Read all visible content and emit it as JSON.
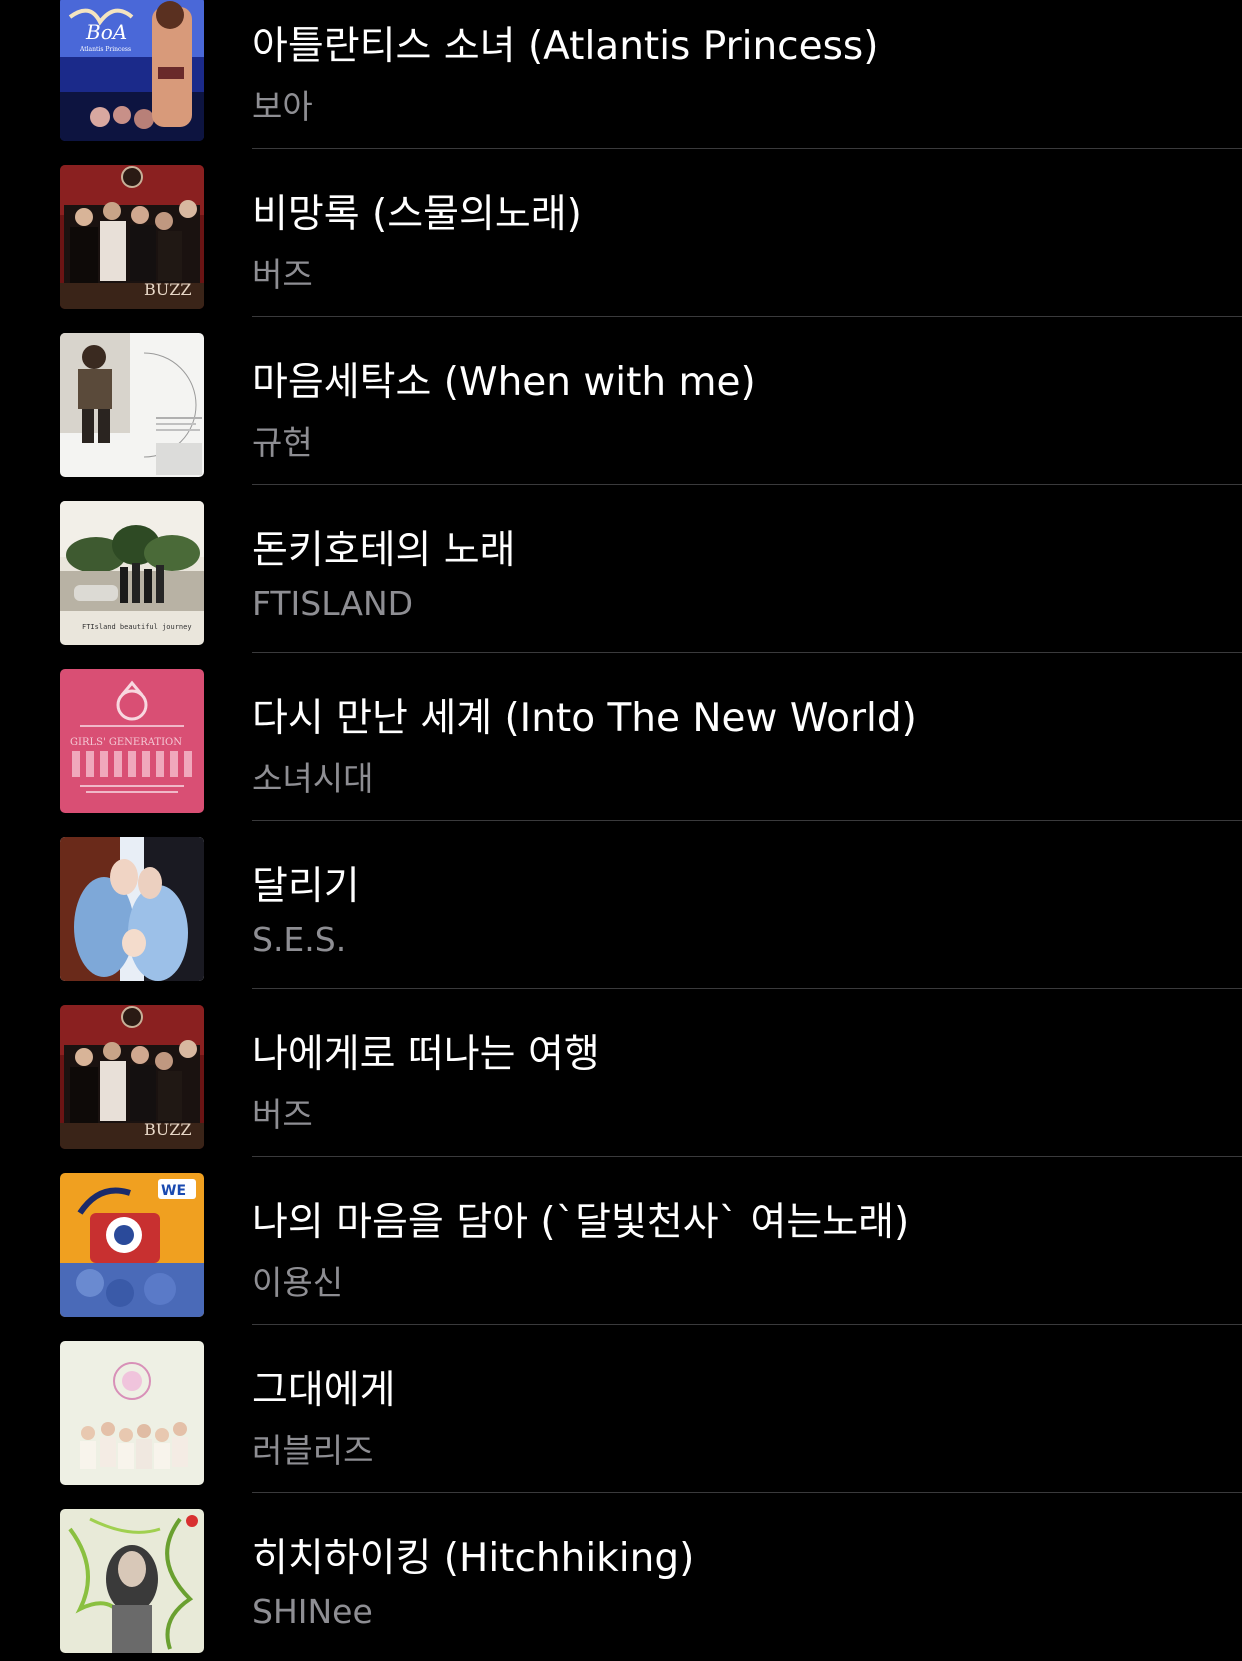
{
  "songs": [
    {
      "title": "아틀란티스 소녀 (Atlantis Princess)",
      "artist": "보아",
      "artwork": "album-art-boa-atlantis-princess",
      "art_text": "BoA",
      "art_subtext": "Atlantis Princess"
    },
    {
      "title": "비망록 (스물의노래)",
      "artist": "버즈",
      "artwork": "album-art-buzz",
      "art_text": "BUZZ"
    },
    {
      "title": "마음세탁소 (When with me)",
      "artist": "규현",
      "artwork": "album-art-kyuhyun"
    },
    {
      "title": "돈키호테의 노래",
      "artist": "FTISLAND",
      "artwork": "album-art-ftisland",
      "art_text": "FTIsland beautiful journey"
    },
    {
      "title": "다시 만난 세계 (Into The New World)",
      "artist": "소녀시대",
      "artwork": "album-art-girls-generation",
      "art_text": "GIRLS' GENERATION"
    },
    {
      "title": "달리기",
      "artist": "S.E.S.",
      "artwork": "album-art-ses"
    },
    {
      "title": "나에게로 떠나는 여행",
      "artist": "버즈",
      "artwork": "album-art-buzz",
      "art_text": "BUZZ"
    },
    {
      "title": "나의 마음을 담아 (`달빛천사` 여는노래)",
      "artist": "이용신",
      "artwork": "album-art-lee-yongshin",
      "art_text": "WE"
    },
    {
      "title": "그대에게",
      "artist": "러블리즈",
      "artwork": "album-art-lovelyz"
    },
    {
      "title": "히치하이킹 (Hitchhiking)",
      "artist": "SHINee",
      "artwork": "album-art-shinee"
    }
  ]
}
